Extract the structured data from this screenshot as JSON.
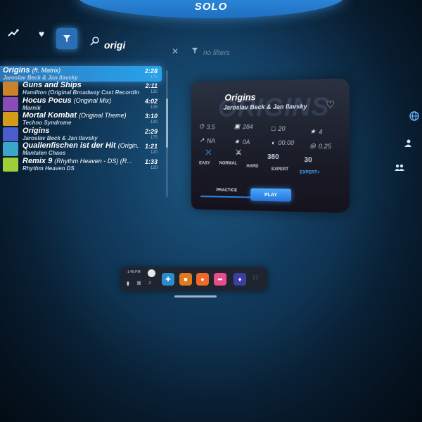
{
  "mode_title": "SOLO",
  "filter_bar": {
    "search_query": "origi",
    "filters_placeholder": "no filters"
  },
  "songs": [
    {
      "title": "Origins",
      "subtitle": "(ft. Matrix)",
      "artist": "Jaroslav Beck & Jan Ilavsky",
      "duration": "2:28",
      "bpm": "175",
      "cover_color": "#2a7ad2",
      "selected": true
    },
    {
      "title": "Guns and Ships",
      "subtitle": "",
      "artist": "Hamilton (Original Broadway Cast Recording)",
      "duration": "2:11",
      "bpm": "130",
      "cover_color": "#c9832b",
      "selected": false
    },
    {
      "title": "Hocus Pocus",
      "subtitle": "(Original Mix)",
      "artist": "Marnik",
      "duration": "4:02",
      "bpm": "128",
      "cover_color": "#8a4bb8",
      "selected": false
    },
    {
      "title": "Mortal Kombat",
      "subtitle": "(Original Theme)",
      "artist": "Techno Syndrome",
      "duration": "3:10",
      "bpm": "130",
      "cover_color": "#d49b1a",
      "selected": false
    },
    {
      "title": "Origins",
      "subtitle": "",
      "artist": "Jaroslav Beck & Jan Ilavsky",
      "duration": "2:29",
      "bpm": "175",
      "cover_color": "#4b5ccc",
      "selected": false
    },
    {
      "title": "Quallenfischen ist der Hit",
      "subtitle": "(Origin...",
      "artist": "Mantalen Chaos",
      "duration": "1:21",
      "bpm": "120",
      "cover_color": "#3aa6c8",
      "selected": false
    },
    {
      "title": "Remix 9",
      "subtitle": "(Rhythm Heaven - DS) (R...",
      "artist": "Rhythm Heaven DS",
      "duration": "1:33",
      "bpm": "120",
      "cover_color": "#9ccf3a",
      "selected": false
    }
  ],
  "detail": {
    "title": "Origins",
    "artist": "Jaroslav Beck & Jan Ilavsky",
    "art_text": "ORIGINS",
    "stats": {
      "njs": "3.5",
      "notes": "284",
      "obstacles": "20",
      "stars": "4",
      "ranked": "NA",
      "score": "0A",
      "accuracy": "00.00",
      "offset": "0.25"
    },
    "difficulty_counts": [
      "",
      "",
      "",
      "380",
      "30"
    ],
    "difficulties": [
      {
        "label": "EASY",
        "active": false
      },
      {
        "label": "NORMAL",
        "active": false
      },
      {
        "label": "HARD",
        "active": false
      },
      {
        "label": "EXPERT",
        "active": false
      },
      {
        "label": "EXPERT+",
        "active": true
      }
    ],
    "practice_label": "PRACTICE",
    "play_label": "PLAY"
  },
  "taskbar": {
    "time": "1:49 PM"
  }
}
